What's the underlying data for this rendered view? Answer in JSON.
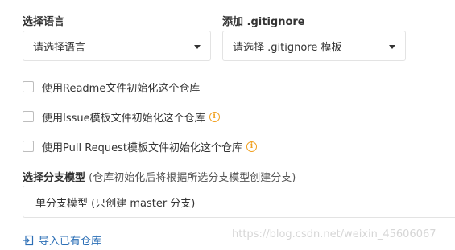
{
  "language": {
    "label": "选择语言",
    "select_value": "请选择语言"
  },
  "gitignore": {
    "label": "添加 .gitignore",
    "select_value": "请选择 .gitignore 模板"
  },
  "checkboxes": [
    {
      "label": "使用Readme文件初始化这个仓库",
      "checked": false,
      "has_info": false
    },
    {
      "label": "使用Issue模板文件初始化这个仓库",
      "checked": false,
      "has_info": true
    },
    {
      "label": "使用Pull Request模板文件初始化这个仓库",
      "checked": false,
      "has_info": true
    }
  ],
  "branch_model": {
    "label_bold": "选择分支模型",
    "label_note": "(仓库初始化后将根据所选分支模型创建分支)",
    "value": "单分支模型 (只创建 master 分支)"
  },
  "import_link": {
    "label": "导入已有仓库"
  },
  "watermark": "https://blog.csdn.net/weixin_45606067",
  "colors": {
    "accent": "#2c6fb6",
    "info": "#f0a020"
  },
  "icons": {
    "info": "info-icon",
    "import": "import-icon",
    "caret": "chevron-down-icon"
  }
}
